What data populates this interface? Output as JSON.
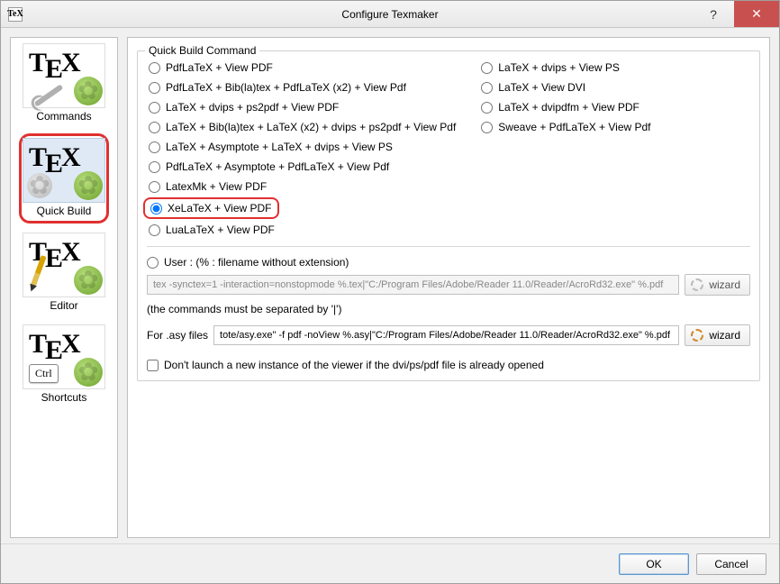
{
  "window": {
    "title": "Configure Texmaker",
    "help_icon": "?",
    "close_icon": "✕",
    "app_icon_text": "TeX"
  },
  "sidebar": {
    "items": [
      {
        "label": "Commands",
        "kind": "commands"
      },
      {
        "label": "Quick Build",
        "kind": "quickbuild",
        "selected": true
      },
      {
        "label": "Editor",
        "kind": "editor"
      },
      {
        "label": "Shortcuts",
        "kind": "shortcuts",
        "ctrl_text": "Ctrl"
      }
    ]
  },
  "quickbuild": {
    "group_title": "Quick Build Command",
    "col1": [
      "PdfLaTeX + View PDF",
      "PdfLaTeX + Bib(la)tex + PdfLaTeX (x2) + View Pdf",
      "LaTeX + dvips + ps2pdf + View PDF",
      "LaTeX + Bib(la)tex + LaTeX (x2) + dvips + ps2pdf + View Pdf",
      "LaTeX + Asymptote + LaTeX + dvips + View PS",
      "PdfLaTeX + Asymptote + PdfLaTeX + View Pdf",
      "LatexMk + View PDF",
      "XeLaTeX + View PDF",
      "LuaLaTeX + View PDF"
    ],
    "col2": [
      "LaTeX + dvips + View PS",
      "LaTeX + View DVI",
      "LaTeX + dvipdfm + View PDF",
      "Sweave + PdfLaTeX + View Pdf"
    ],
    "selected": "XeLaTeX + View PDF",
    "user_label": "User : (% : filename without extension)",
    "user_cmd": "tex -synctex=1 -interaction=nonstopmode %.tex|\"C:/Program Files/Adobe/Reader 11.0/Reader/AcroRd32.exe\" %.pdf",
    "wizard_label": "wizard",
    "separator_hint": "(the commands must be separated by '|')",
    "asy_label": "For .asy files",
    "asy_cmd": "tote/asy.exe\" -f pdf -noView %.asy|\"C:/Program Files/Adobe/Reader 11.0/Reader/AcroRd32.exe\" %.pdf",
    "dont_launch_label": "Don't launch a new instance of the viewer if the dvi/ps/pdf file is already opened",
    "dont_launch_checked": false
  },
  "buttons": {
    "ok": "OK",
    "cancel": "Cancel"
  }
}
